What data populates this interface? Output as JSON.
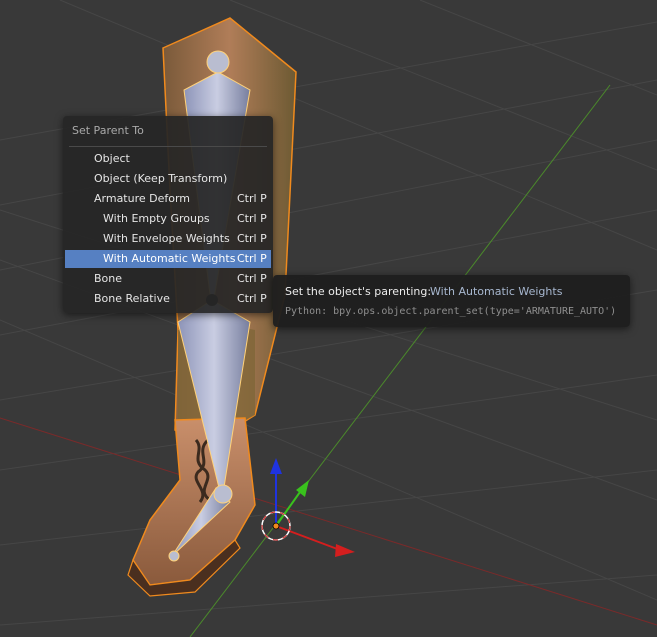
{
  "menu": {
    "title": "Set Parent To",
    "items": [
      {
        "label": "Object",
        "shortcut": "",
        "indent": false,
        "active": false
      },
      {
        "label": "Object (Keep Transform)",
        "shortcut": "",
        "indent": false,
        "active": false
      },
      {
        "label": "Armature Deform",
        "shortcut": "Ctrl P",
        "indent": false,
        "active": false
      },
      {
        "label": "With Empty Groups",
        "shortcut": "Ctrl P",
        "indent": true,
        "active": false
      },
      {
        "label": "With Envelope Weights",
        "shortcut": "Ctrl P",
        "indent": true,
        "active": false
      },
      {
        "label": "With Automatic Weights",
        "shortcut": "Ctrl P",
        "indent": true,
        "active": true
      },
      {
        "label": "Bone",
        "shortcut": "Ctrl P",
        "indent": false,
        "active": false
      },
      {
        "label": "Bone Relative",
        "shortcut": "Ctrl P",
        "indent": false,
        "active": false
      }
    ]
  },
  "tooltip": {
    "label": "Set the object's parenting:",
    "value": "With Automatic Weights",
    "python": "Python: bpy.ops.object.parent_set(type='ARMATURE_AUTO')"
  },
  "colors": {
    "viewport_bg": "#393939",
    "menu_highlight": "#5680c2",
    "selection_outline": "#f08a1d",
    "x_axis": "#d41e1e",
    "y_axis": "#39c21d",
    "z_axis": "#1f33e0"
  },
  "icons": {
    "transform_gizmo": "3d-cursor-and-manipulator",
    "scene_object": "boot-mesh-with-armature-bones"
  }
}
